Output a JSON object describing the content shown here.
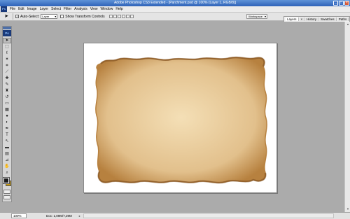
{
  "window": {
    "title": "Adobe Photoshop CS3 Extended - [Parchment.psd @ 100% (Layer 1, RGB/8)]",
    "controls": [
      "_",
      "□",
      "×"
    ]
  },
  "app_logo": "Ps",
  "menu": [
    "File",
    "Edit",
    "Image",
    "Layer",
    "Select",
    "Filter",
    "Analysis",
    "View",
    "Window",
    "Help"
  ],
  "options": {
    "tool_icon": "move-arrow",
    "tool_glyph": "➤",
    "auto_select_label": "Auto-Select:",
    "auto_select_checked": true,
    "auto_select_check": "✓",
    "auto_select_value": "Layer",
    "show_transform_label": "Show Transform Controls",
    "show_transform_checked": false,
    "workspace_label": "Workspace"
  },
  "panels": {
    "tabs": [
      "Layers",
      "History",
      "Swatches",
      "Paths"
    ],
    "close_glyph": "×",
    "active_tab": "Layers"
  },
  "toolbox": {
    "logo": "Ps",
    "tools": [
      {
        "name": "move-tool-icon",
        "glyph": "➤"
      },
      {
        "name": "marquee-tool-icon",
        "glyph": "⬚"
      },
      {
        "name": "lasso-tool-icon",
        "glyph": "ℓ"
      },
      {
        "name": "magic-wand-tool-icon",
        "glyph": "✶"
      },
      {
        "name": "crop-tool-icon",
        "glyph": "⌗"
      },
      {
        "name": "slice-tool-icon",
        "glyph": "⟋"
      },
      {
        "name": "healing-brush-tool-icon",
        "glyph": "✚"
      },
      {
        "name": "brush-tool-icon",
        "glyph": "✎"
      },
      {
        "name": "clone-stamp-tool-icon",
        "glyph": "♜"
      },
      {
        "name": "history-brush-tool-icon",
        "glyph": "↺"
      },
      {
        "name": "eraser-tool-icon",
        "glyph": "▭"
      },
      {
        "name": "gradient-tool-icon",
        "glyph": "▦"
      },
      {
        "name": "blur-tool-icon",
        "glyph": "●"
      },
      {
        "name": "dodge-tool-icon",
        "glyph": "◐"
      },
      {
        "name": "pen-tool-icon",
        "glyph": "✒"
      },
      {
        "name": "type-tool-icon",
        "glyph": "T"
      },
      {
        "name": "path-selection-tool-icon",
        "glyph": "↖"
      },
      {
        "name": "shape-tool-icon",
        "glyph": "▬"
      },
      {
        "name": "notes-tool-icon",
        "glyph": "▤"
      },
      {
        "name": "eyedropper-tool-icon",
        "glyph": "⊿"
      },
      {
        "name": "hand-tool-icon",
        "glyph": "✋"
      },
      {
        "name": "zoom-tool-icon",
        "glyph": "⌕"
      }
    ],
    "foreground_color": "#1a1a1a",
    "background_color": "#c89a10"
  },
  "canvas": {
    "background_color": "#ffffff",
    "parchment_colors": {
      "center": "#f4dfb6",
      "mid": "#e2c08c",
      "edge": "#b7813f",
      "shadow": "#7a4a1e"
    }
  },
  "statusbar": {
    "zoom": "100%",
    "doc_info": "Doc: 1,09M/7,39M",
    "arrow": "▸"
  },
  "scrollbar": {
    "up": "▲",
    "down": "▼"
  }
}
